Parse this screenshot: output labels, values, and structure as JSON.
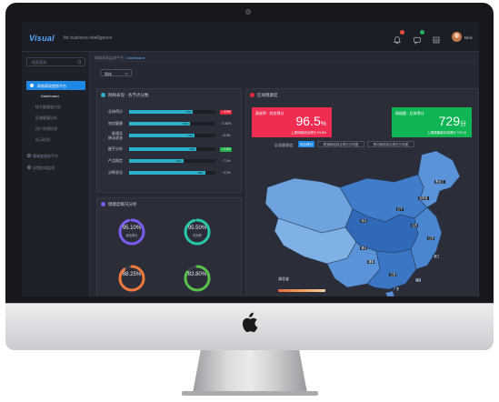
{
  "brand": {
    "name": "Visual",
    "subtitle": "for business intelligence"
  },
  "header": {
    "user_name": "Nick",
    "icons": [
      "bell-icon",
      "message-icon",
      "grid-icon"
    ]
  },
  "sidebar": {
    "search_placeholder": "搜索菜单...",
    "active_group": "网络表现趋势平台",
    "sub_items": [
      "Dashboard",
      "帐号健康度分析",
      "区域健康分析",
      "用户异常检测",
      "告示检测"
    ],
    "groups": [
      "健康度趋势平台",
      "异常检测监测"
    ]
  },
  "breadcrumb": {
    "path": "网络表现监测平台 / ",
    "current": "Dashboard"
  },
  "filter_select": {
    "value": "简体"
  },
  "bar_panel": {
    "title": "网络表现 · 各节点分数",
    "rows": [
      {
        "label": "总体得分",
        "value": "74%",
        "fill": 0.74,
        "badge": "↓ 3.9%",
        "badge_color": "#e5293f"
      },
      {
        "label": "电信健康",
        "value": "70%",
        "fill": 0.7,
        "badge": "↑ 0.92%",
        "badge_color": ""
      },
      {
        "label": "联通及\n移动状态",
        "value": "76%",
        "fill": 0.76,
        "badge": "↑ 5.3%",
        "badge_color": ""
      },
      {
        "label": "握手分析",
        "value": "78%",
        "fill": 0.78,
        "badge": "↑ 2.4%",
        "badge_color": "#24b24f"
      },
      {
        "label": "产品稳定",
        "value": "63%",
        "fill": 0.63,
        "badge": "↑ 7.1%",
        "badge_color": ""
      },
      {
        "label": "诊断状况",
        "value": "88%",
        "fill": 0.88,
        "badge": "↑ 3.2%",
        "badge_color": ""
      }
    ]
  },
  "ring_panel": {
    "title": "健康度概况分析",
    "rings": [
      {
        "value": "95.10%",
        "label": "综合得分",
        "fraction": 0.951,
        "color": "#7b5cf0"
      },
      {
        "value": "95.50%",
        "label": "可用率",
        "fraction": 0.955,
        "color": "#27c9a8"
      },
      {
        "value": "88.25%",
        "label": "",
        "fraction": 0.8825,
        "color": "#f07a3c"
      },
      {
        "value": "83.80%",
        "label": "",
        "fraction": 0.838,
        "color": "#58c24a"
      }
    ]
  },
  "map_panel": {
    "title": "区域健康度",
    "kpis": [
      {
        "title": "高效率 · 综合得分",
        "value": "96.5",
        "unit": "%",
        "sub": "上周网络综合得分 93.8%",
        "color": "#ef2d52"
      },
      {
        "title": "网络健 · 总体得分",
        "value": "729",
        "unit": "分",
        "sub": "上周健康度总体得分 703 分",
        "color": "#10b554"
      }
    ],
    "filter_label": "区域健康度：",
    "filters": [
      {
        "label": "综合得分",
        "active": true
      },
      {
        "label": "联通网络综合得分分布图",
        "active": false
      },
      {
        "label": "移动网络综合得分分布图",
        "active": false
      }
    ],
    "labels": [
      "黑龙江",
      "吉林省",
      "辽宁",
      "河北",
      "山东",
      "江苏",
      "湖北",
      "浙江",
      "福建",
      "广东",
      "湖南",
      "江西"
    ],
    "legend_title": "湖北省"
  },
  "colors": {
    "accent": "#1e88e5",
    "panel": "#2b2e39",
    "screen": "#262933"
  }
}
